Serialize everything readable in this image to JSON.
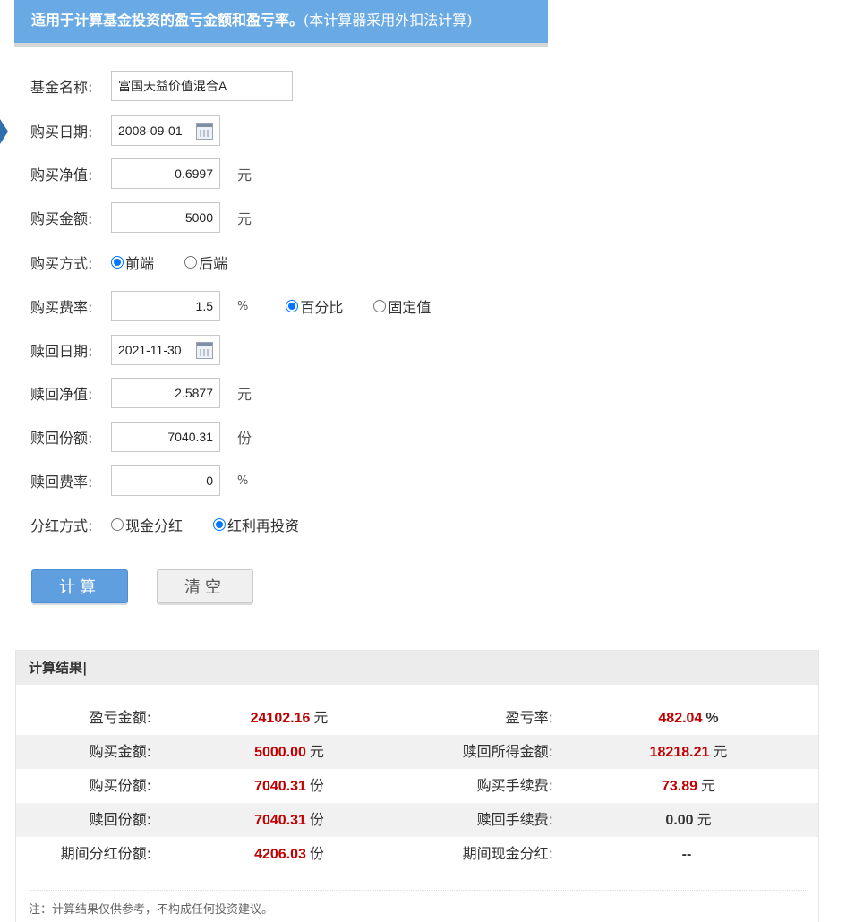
{
  "banner": {
    "title": "适用于计算基金投资的盈亏金额和盈亏率。",
    "note": "(本计算器采用外扣法计算)"
  },
  "form": {
    "fund_name": {
      "label": "基金名称:",
      "value": "富国天益价值混合A"
    },
    "buy_date": {
      "label": "购买日期:",
      "value": "2008-09-01"
    },
    "buy_nav": {
      "label": "购买净值:",
      "value": "0.6997",
      "unit": "元"
    },
    "buy_amount": {
      "label": "购买金额:",
      "value": "5000",
      "unit": "元"
    },
    "buy_mode": {
      "label": "购买方式:",
      "options": [
        "前端",
        "后端"
      ],
      "selected": "前端"
    },
    "buy_fee_rate": {
      "label": "购买费率:",
      "value": "1.5",
      "unit": "%",
      "options": [
        "百分比",
        "固定值"
      ],
      "selected": "百分比"
    },
    "redeem_date": {
      "label": "赎回日期:",
      "value": "2021-11-30"
    },
    "redeem_nav": {
      "label": "赎回净值:",
      "value": "2.5877",
      "unit": "元"
    },
    "redeem_shares": {
      "label": "赎回份额:",
      "value": "7040.31",
      "unit": "份"
    },
    "redeem_fee_rate": {
      "label": "赎回费率:",
      "value": "0",
      "unit": "%"
    },
    "dividend_mode": {
      "label": "分红方式:",
      "options": [
        "现金分红",
        "红利再投资"
      ],
      "selected": "红利再投资"
    }
  },
  "buttons": {
    "calculate": "计算",
    "clear": "清空"
  },
  "result": {
    "title": "计算结果|",
    "rows": [
      {
        "k1": "盈亏金额:",
        "v1": "24102.16",
        "u1": "元",
        "k2": "盈亏率:",
        "v2": "482.04",
        "u2": "%"
      },
      {
        "k1": "购买金额:",
        "v1": "5000.00",
        "u1": "元",
        "k2": "赎回所得金额:",
        "v2": "18218.21",
        "u2": "元"
      },
      {
        "k1": "购买份额:",
        "v1": "7040.31",
        "u1": "份",
        "k2": "购买手续费:",
        "v2": "73.89",
        "u2": "元"
      },
      {
        "k1": "赎回份额:",
        "v1": "7040.31",
        "u1": "份",
        "k2": "赎回手续费:",
        "v2": "0.00",
        "u2": "元"
      },
      {
        "k1": "期间分红份额:",
        "v1": "4206.03",
        "u1": "份",
        "k2": "期间现金分红:",
        "v2": "--",
        "u2": ""
      }
    ],
    "footnote": "注：计算结果仅供参考，不构成任何投资建议。"
  },
  "colors": {
    "accent": "#6aaae4",
    "value_red": "#c00000",
    "radio_blue": "#0075ff"
  }
}
